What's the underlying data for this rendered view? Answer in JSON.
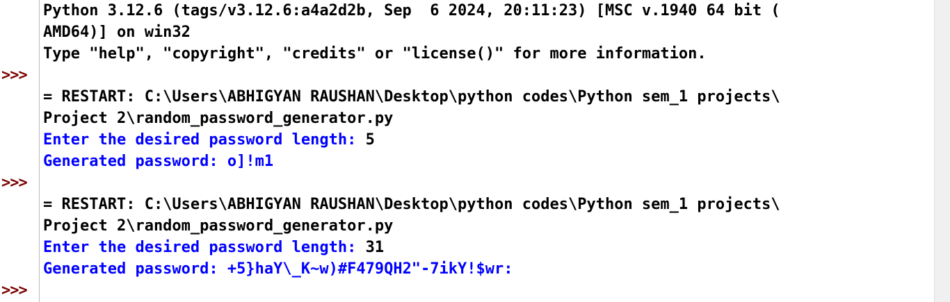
{
  "shell": {
    "prompt": ">>>",
    "banner": [
      "Python 3.12.6 (tags/v3.12.6:a4a2d2b, Sep  6 2024, 20:11:23) [MSC v.1940 64 bit (",
      "AMD64)] on win32",
      "Type \"help\", \"copyright\", \"credits\" or \"license()\" for more information."
    ],
    "runs": [
      {
        "restart_line1": "= RESTART: C:\\Users\\ABHIGYAN RAUSHAN\\Desktop\\python codes\\Python sem_1 projects\\",
        "restart_line2": "Project 2\\random_password_generator.py",
        "input_prompt": "Enter the desired password length: ",
        "input_value": "5",
        "output_label": "Generated password: ",
        "output_value": "o]!m1"
      },
      {
        "restart_line1": "= RESTART: C:\\Users\\ABHIGYAN RAUSHAN\\Desktop\\python codes\\Python sem_1 projects\\",
        "restart_line2": "Project 2\\random_password_generator.py",
        "input_prompt": "Enter the desired password length: ",
        "input_value": "31",
        "output_label": "Generated password: ",
        "output_value": "+5}haY\\_K~w)#F479QH2\"-7ikY!$wr:"
      }
    ]
  },
  "colors": {
    "prompt": "#7a0000",
    "stdout": "#0000ff",
    "text": "#000000",
    "background": "#ffffff"
  }
}
